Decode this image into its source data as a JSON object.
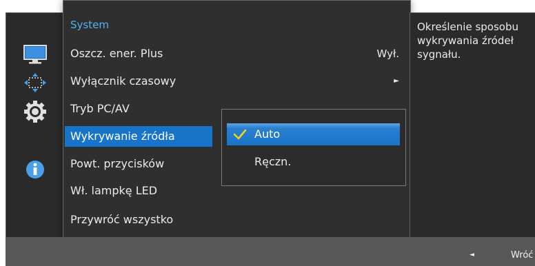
{
  "sidebar": {
    "icons": [
      "monitor-icon",
      "resize-arrows-icon",
      "gear-icon",
      "info-icon"
    ],
    "colors": {
      "accent": "#1874c9",
      "icon_blue": "#4aa0e6"
    }
  },
  "menu": {
    "title": "System",
    "items": [
      {
        "label": "Oszcz. ener. Plus",
        "value": "Wył."
      },
      {
        "label": "Wyłącznik czasowy",
        "value": "►"
      },
      {
        "label": "Tryb PC/AV",
        "value": ""
      },
      {
        "label": "Wykrywanie źródła",
        "value": ""
      },
      {
        "label": "Powt. przycisków",
        "value": ""
      },
      {
        "label": "Wł. lampkę LED",
        "value": ""
      },
      {
        "label": "Przywróć wszystko",
        "value": ""
      }
    ],
    "selected_index": 3
  },
  "submenu": {
    "options": [
      {
        "label": "Auto",
        "checked": true
      },
      {
        "label": "Ręczn.",
        "checked": false
      }
    ]
  },
  "help": {
    "text": "Określenie sposobu wykrywania źródeł sygnału."
  },
  "footer": {
    "back_arrow": "◄",
    "back_label": "Wróć"
  }
}
